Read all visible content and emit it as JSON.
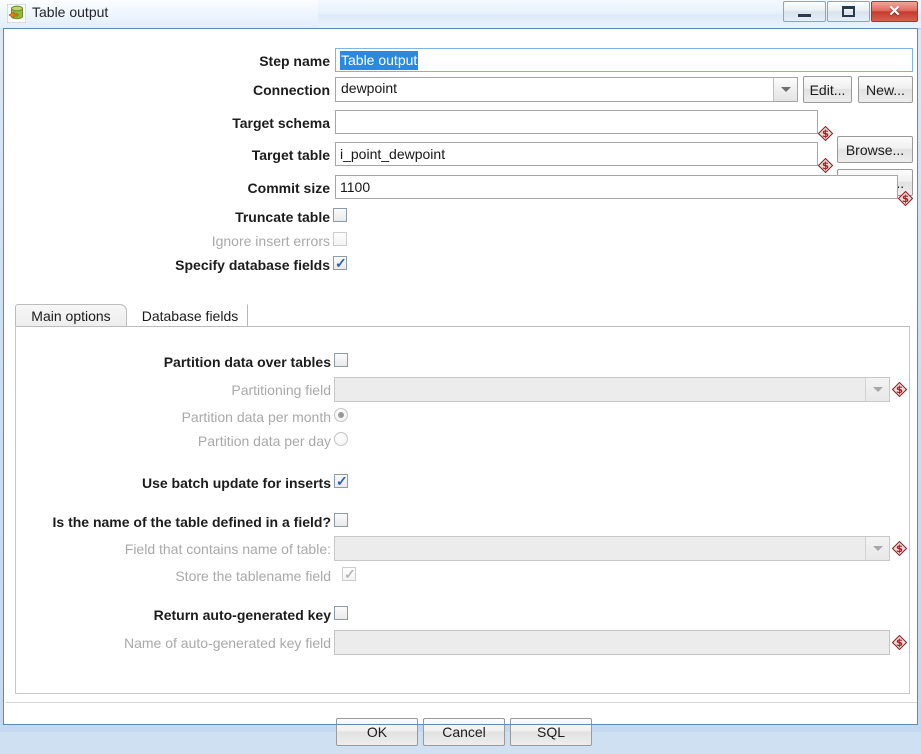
{
  "window": {
    "title": "Table output",
    "icon": "table-output-icon",
    "controls": {
      "minimize": "minimize-button",
      "maximize": "maximize-button",
      "close": "close-button"
    }
  },
  "header_form": {
    "step_name": {
      "label": "Step name",
      "value": "Table output",
      "selected": true
    },
    "connection": {
      "label": "Connection",
      "value": "dewpoint",
      "edit_label": "Edit...",
      "new_label": "New..."
    },
    "target_schema": {
      "label": "Target schema",
      "value": "",
      "browse_label": "Browse..."
    },
    "target_table": {
      "label": "Target table",
      "value": "i_point_dewpoint",
      "browse_label": "Browse..."
    },
    "commit_size": {
      "label": "Commit size",
      "value": "1100"
    },
    "truncate_table": {
      "label": "Truncate table",
      "checked": false,
      "enabled": true
    },
    "ignore_insert_errors": {
      "label": "Ignore insert errors",
      "checked": false,
      "enabled": false
    },
    "specify_database_fields": {
      "label": "Specify database fields",
      "checked": true,
      "enabled": true
    }
  },
  "tabs": [
    {
      "label": "Main options",
      "active": true
    },
    {
      "label": "Database fields",
      "active": false
    }
  ],
  "main_options": {
    "partition_data_over_tables": {
      "label": "Partition data over tables",
      "checked": false,
      "enabled": true
    },
    "partitioning_field": {
      "label": "Partitioning field",
      "value": "",
      "enabled": false
    },
    "partition_data_per_month": {
      "label": "Partition data per month",
      "selected": true,
      "enabled": false
    },
    "partition_data_per_day": {
      "label": "Partition data per day",
      "selected": false,
      "enabled": false
    },
    "use_batch_update": {
      "label": "Use batch update for inserts",
      "checked": true,
      "enabled": true
    },
    "table_name_in_field": {
      "label": "Is the name of the table defined in a field?",
      "checked": false,
      "enabled": true
    },
    "field_contains_table_name": {
      "label": "Field that contains name of table:",
      "value": "",
      "enabled": false
    },
    "store_tablename_field": {
      "label": "Store the tablename field",
      "checked": true,
      "enabled": false
    },
    "return_auto_generated_key": {
      "label": "Return auto-generated key",
      "checked": false,
      "enabled": true
    },
    "auto_generated_key_field": {
      "label": "Name of auto-generated key field",
      "value": "",
      "enabled": false
    }
  },
  "footer": {
    "ok_label": "OK",
    "cancel_label": "Cancel",
    "sql_label": "SQL"
  },
  "colors": {
    "selection_blue": "#2a8ae0",
    "title_bar": "#eaf3fc",
    "close_red": "#c43a2e",
    "variable_marker": "#a02020",
    "disabled_text": "#a9a9a9"
  }
}
